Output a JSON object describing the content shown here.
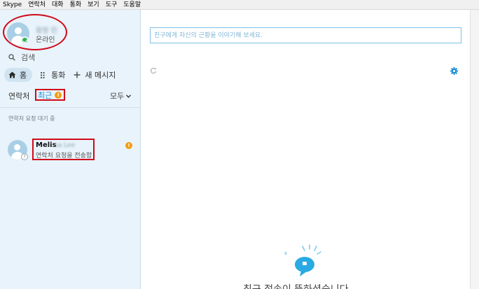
{
  "menu": {
    "items": [
      "Skype",
      "연락처",
      "대화",
      "통화",
      "보기",
      "도구",
      "도움말"
    ]
  },
  "profile": {
    "name": "황정 민",
    "status": "온라인",
    "status_color": "#2bb24c"
  },
  "search": {
    "label": "검색",
    "icon": "search-icon"
  },
  "nav": {
    "home": "홈",
    "calls": "통화",
    "new_message": "새 메시지"
  },
  "tabs": {
    "contacts": "연락처",
    "recent": "최근",
    "recent_badge": "!",
    "filter": "모두"
  },
  "contacts_section": {
    "label": "연락처 요청 대기 중",
    "items": [
      {
        "name_visible": "Melis",
        "name_blurred": "sa Lee",
        "subtitle": "연락처 요청을 전송함",
        "badge": "!",
        "pending_icon": "?"
      }
    ]
  },
  "main": {
    "mood_placeholder": "친구에게 자신의 근황을 이야기해 보세요.",
    "empty_message": "최근 접속이 뜸하셨습니다"
  },
  "colors": {
    "accent": "#1a8fd6",
    "sidebar_bg": "#e8f3fb",
    "badge": "#f39c12",
    "highlight": "#d10a1a"
  }
}
